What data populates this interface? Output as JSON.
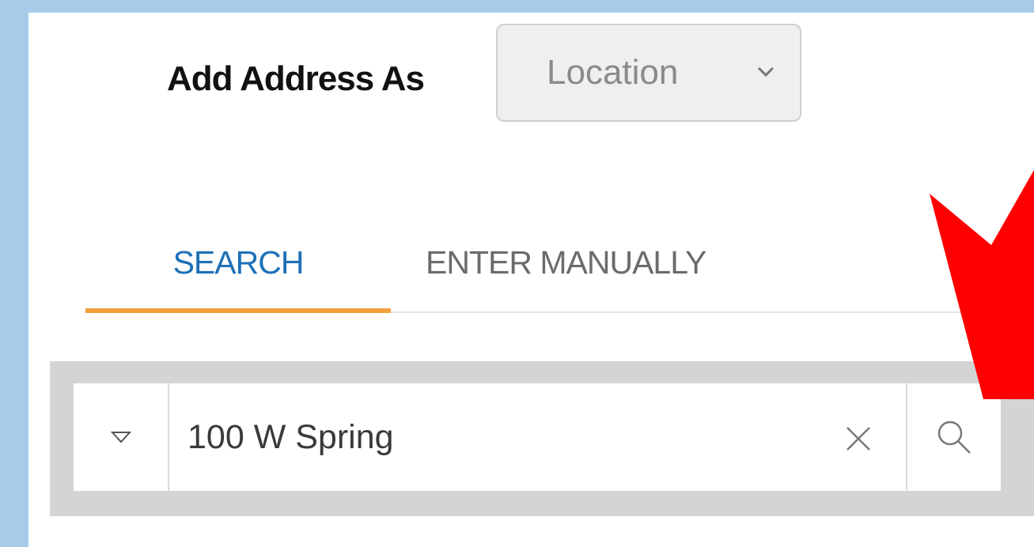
{
  "header": {
    "label": "Add Address As"
  },
  "address_type_select": {
    "selected": "Location",
    "icon": "chevron-down-icon"
  },
  "tabs": [
    {
      "label": "SEARCH",
      "active": true
    },
    {
      "label": "ENTER MANUALLY",
      "active": false
    }
  ],
  "search": {
    "value": "100 W Spring",
    "filter_icon": "triangle-down-icon",
    "clear_icon": "close-icon",
    "search_icon": "search-icon"
  },
  "colors": {
    "active_tab": "#1d70b7",
    "active_underline": "#f4a03c",
    "annotation_arrow": "#ff0000"
  }
}
